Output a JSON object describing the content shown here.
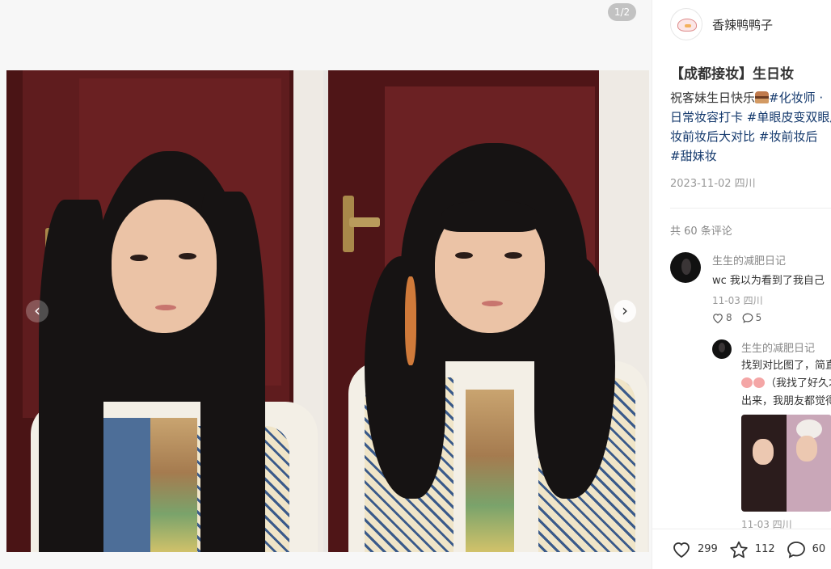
{
  "media": {
    "counter": "1/2",
    "prev_label": "‹",
    "next_label": "›"
  },
  "author": {
    "name": "香辣鸭鸭子"
  },
  "note": {
    "title": "【成都接妆】生日妆",
    "body_line1_prefix": "祝客妹生日快乐",
    "tags_line1": "#化妆师",
    "tail_line1": " ·",
    "tags_line2": "日常妆容打卡 #单眼皮变双眼皮",
    "tags_line3": "妆前妆后大对比 #妆前妆后",
    "tags_line4": "#甜妹妆",
    "date": "2023-11-02 四川"
  },
  "comments_section": {
    "count_text": "共 60 条评论"
  },
  "comment": {
    "user": "生生的减肥日记",
    "text": "wc 我以为看到了我自己",
    "meta": "11-03 四川",
    "likes": "8",
    "replies": "5"
  },
  "reply": {
    "user": "生生的减肥日记",
    "line1": "找到对比图了，简直",
    "line2": "（我找了好久才",
    "line3": "出来，我朋友都觉得",
    "meta": "11-03 四川"
  },
  "bottom_bar": {
    "likes": "299",
    "collects": "112",
    "comments": "60"
  },
  "colors": {
    "tag": "#13386c",
    "muted": "#999999",
    "text": "#333333"
  }
}
